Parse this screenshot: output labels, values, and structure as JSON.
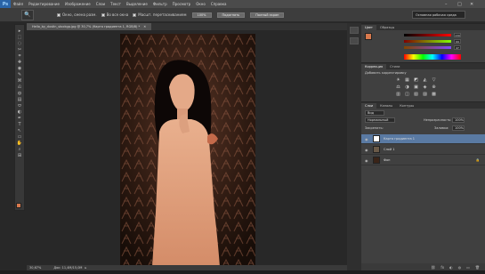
{
  "app": {
    "logo": "Ps"
  },
  "menu": [
    "Файл",
    "Редактирование",
    "Изображение",
    "Слои",
    "Текст",
    "Выделение",
    "Фильтр",
    "Просмотр",
    "Окно",
    "Справка"
  ],
  "window_controls": {
    "minimize": "–",
    "maximize": "□",
    "close": "✕"
  },
  "options": {
    "tool_glyph": "🔍",
    "checkbox1": "Окно, смена разм.",
    "checkbox2": "Во все окна",
    "checkbox3": "Масшт. перетаскиванием",
    "zoom_btn": "100%",
    "fit_btn": "Подогнать",
    "fill_btn": "Полный экран",
    "workspace": "Основная рабочая среда"
  },
  "document": {
    "tab_title": "Hello_by_dustin_stockgp.jpg @ 30,7% (Карта градиента 1, RGB/8) *",
    "zoom": "30,67%",
    "doc_size": "Док: 11,4M/15,0M"
  },
  "tools": [
    "▸",
    "⬚",
    "◌",
    "✂",
    "⌗",
    "✚",
    "◉",
    "✎",
    "⌘",
    "⎌",
    "◍",
    "▤",
    "⬭",
    "◐",
    "✒",
    "T",
    "↖",
    "▭",
    "✋",
    "⌕",
    "⊞"
  ],
  "colors": {
    "foreground": "#d8794d",
    "background": "#ffffff",
    "accent": "#2a64a8"
  },
  "color_panel": {
    "tab_color": "Цвет",
    "tab_swatches": "Образцы",
    "r": "130",
    "g": "69",
    "b": "47"
  },
  "adjustments_panel": {
    "tab_adjust": "Коррекция",
    "tab_styles": "Стили",
    "title": "Добавить корректировку",
    "icons": [
      "☀",
      "▦",
      "◩",
      "◭",
      "▽",
      "⚖",
      "◑",
      "▣",
      "◈",
      "⊕",
      "▥",
      "◫",
      "▧",
      "▨",
      "▩"
    ]
  },
  "layers_panel": {
    "tabs": [
      "Слои",
      "Каналы",
      "Контуры"
    ],
    "kind": "Вид",
    "blend_mode": "Нормальный",
    "opacity_label": "Непрозрачность:",
    "opacity": "100%",
    "lock_label": "Закрепить:",
    "fill_label": "Заливка:",
    "fill": "100%",
    "layers": [
      {
        "name": "Карта градиента 1",
        "selected": true
      },
      {
        "name": "Слой 1",
        "selected": false
      },
      {
        "name": "Фон",
        "selected": false
      }
    ],
    "footer_icons": [
      "⛓",
      "fx",
      "◐",
      "◍",
      "▭",
      "🗑"
    ]
  }
}
